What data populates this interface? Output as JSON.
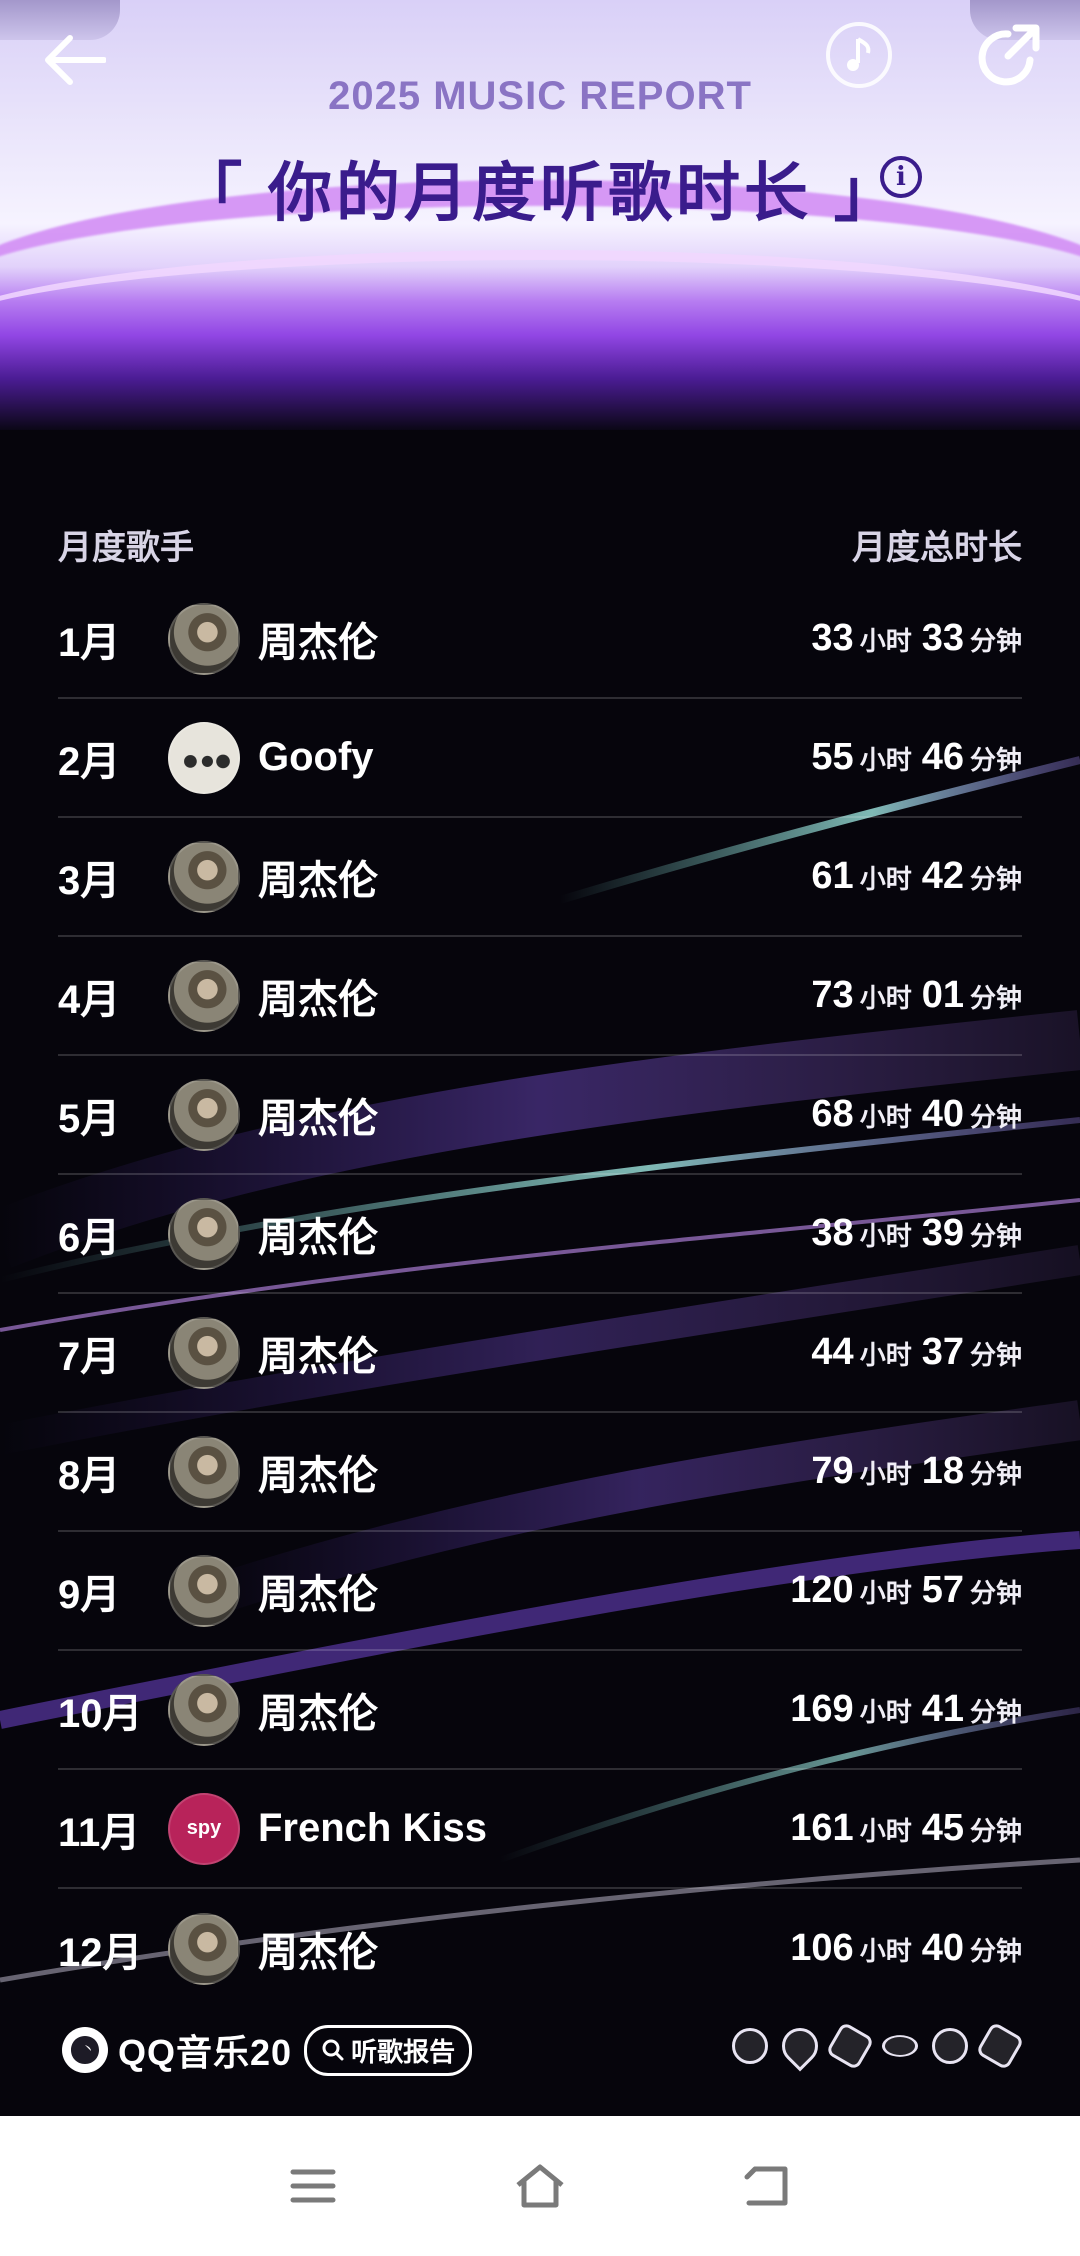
{
  "header": {
    "subtitle": "2025 MUSIC REPORT",
    "title": "「 你的月度听歌时长 」",
    "info_glyph": "i"
  },
  "table": {
    "col_left": "月度歌手",
    "col_right": "月度总时长",
    "hour_unit": "小时",
    "minute_unit": "分钟",
    "rows": [
      {
        "month": "1月",
        "artist": "周杰伦",
        "hours": "33",
        "minutes": "33",
        "avatar": "jay"
      },
      {
        "month": "2月",
        "artist": "Goofy",
        "hours": "55",
        "minutes": "46",
        "avatar": "goofy"
      },
      {
        "month": "3月",
        "artist": "周杰伦",
        "hours": "61",
        "minutes": "42",
        "avatar": "jay"
      },
      {
        "month": "4月",
        "artist": "周杰伦",
        "hours": "73",
        "minutes": "01",
        "avatar": "jay"
      },
      {
        "month": "5月",
        "artist": "周杰伦",
        "hours": "68",
        "minutes": "40",
        "avatar": "jay"
      },
      {
        "month": "6月",
        "artist": "周杰伦",
        "hours": "38",
        "minutes": "39",
        "avatar": "jay"
      },
      {
        "month": "7月",
        "artist": "周杰伦",
        "hours": "44",
        "minutes": "37",
        "avatar": "jay"
      },
      {
        "month": "8月",
        "artist": "周杰伦",
        "hours": "79",
        "minutes": "18",
        "avatar": "jay"
      },
      {
        "month": "9月",
        "artist": "周杰伦",
        "hours": "120",
        "minutes": "57",
        "avatar": "jay"
      },
      {
        "month": "10月",
        "artist": "周杰伦",
        "hours": "169",
        "minutes": "41",
        "avatar": "jay"
      },
      {
        "month": "11月",
        "artist": "French Kiss",
        "hours": "161",
        "minutes": "45",
        "avatar": "kiss"
      },
      {
        "month": "12月",
        "artist": "周杰伦",
        "hours": "106",
        "minutes": "40",
        "avatar": "jay"
      }
    ]
  },
  "footer": {
    "brand_name": "QQ音乐20",
    "pill_label": "听歌报告",
    "kiss_avatar_text": "spy"
  },
  "colors": {
    "title": "#3a1c8c",
    "subtitle": "#8a74c4",
    "background": "#06050c"
  }
}
